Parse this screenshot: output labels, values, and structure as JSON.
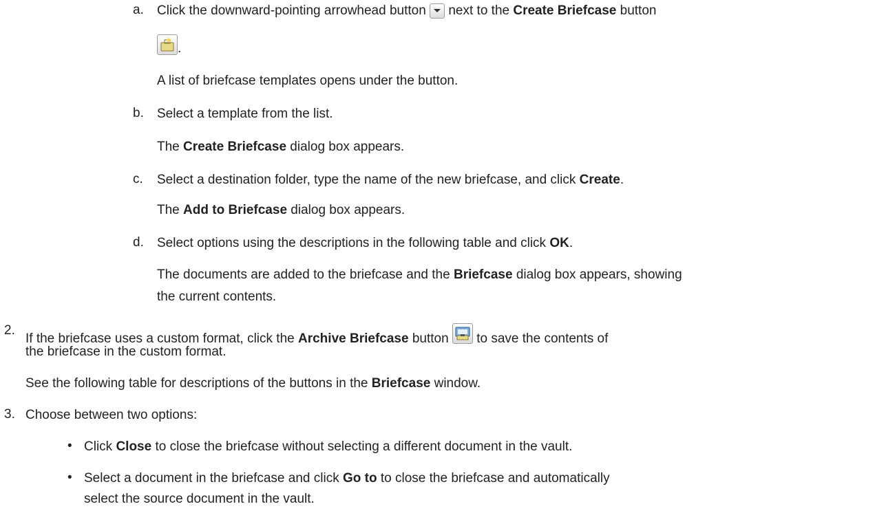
{
  "step1": {
    "a": {
      "marker": "a.",
      "t1": "Click the downward-pointing arrowhead button",
      "t2": "next to the",
      "b1": "Create Briefcase",
      "t3": "button",
      "t4": ".",
      "result": "A list of briefcase templates opens under the button."
    },
    "b": {
      "marker": "b.",
      "text": "Select a template from the list.",
      "r_pre": "The",
      "r_bold": "Create Briefcase",
      "r_post": "dialog box appears."
    },
    "c": {
      "marker": "c.",
      "t1": "Select a destination folder, type the name of the new briefcase, and click",
      "b1": "Create",
      "t2": ".",
      "r_pre": "The",
      "r_bold": "Add to Briefcase",
      "r_post": "dialog box appears."
    },
    "d": {
      "marker": "d.",
      "t1": "Select options using the descriptions in the following table and click",
      "b1": "OK",
      "t2": ".",
      "r1": "The documents are added to the briefcase and the",
      "r_bold": "Briefcase",
      "r2": "dialog box appears, showing",
      "r3": "the current contents."
    }
  },
  "step2": {
    "marker": "2.",
    "t1": "If the briefcase uses a custom format, click the",
    "b1": "Archive Briefcase",
    "t2": "button",
    "t3": "to save the contents of",
    "t4": "the briefcase in the custom format.",
    "n1": "See the following table for descriptions of the buttons in the",
    "n_bold": "Briefcase",
    "n2": "window."
  },
  "step3": {
    "marker": "3.",
    "text": "Choose between two options:",
    "opt1": {
      "t1": "Click",
      "b1": "Close",
      "t2": "to close the briefcase without selecting a different document in the vault."
    },
    "opt2": {
      "t1": "Select a document in the briefcase and click",
      "b1": "Go to",
      "t2": "to close the briefcase and automatically",
      "t3": "select the source document in the vault."
    }
  },
  "icons": [
    "dropdown-arrow-icon",
    "create-briefcase-icon",
    "archive-briefcase-icon"
  ]
}
